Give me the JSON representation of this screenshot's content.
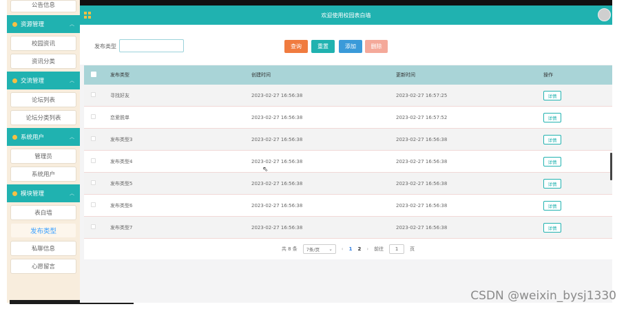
{
  "sidebar": {
    "top_item": "公告信息",
    "groups": [
      {
        "title": "资源管理",
        "items": [
          "校园资讯",
          "资讯分类"
        ]
      },
      {
        "title": "交流管理",
        "items": [
          "论坛列表",
          "论坛分类列表"
        ]
      },
      {
        "title": "系统用户",
        "items": [
          "管理员",
          "系统用户"
        ]
      },
      {
        "title": "模块管理",
        "items": [
          "表白墙",
          "发布类型",
          "私聊信息",
          "心愿留言"
        ]
      }
    ],
    "active_item": "发布类型"
  },
  "header": {
    "title": "欢迎使用校园表白墙"
  },
  "filter": {
    "label": "发布类型",
    "input_value": "",
    "buttons": {
      "search": "查询",
      "reset": "重置",
      "add": "添加",
      "delete": "删除"
    }
  },
  "table": {
    "columns": [
      "发布类型",
      "创建时间",
      "更新时间",
      "操作"
    ],
    "rows": [
      {
        "type": "寻找好友",
        "created": "2023-02-27 16:56:38",
        "updated": "2023-02-27 16:57:25",
        "action": "详情"
      },
      {
        "type": "恋爱脱单",
        "created": "2023-02-27 16:56:38",
        "updated": "2023-02-27 16:57:52",
        "action": "详情"
      },
      {
        "type": "发布类型3",
        "created": "2023-02-27 16:56:38",
        "updated": "2023-02-27 16:56:38",
        "action": "详情"
      },
      {
        "type": "发布类型4",
        "created": "2023-02-27 16:56:38",
        "updated": "2023-02-27 16:56:38",
        "action": "详情"
      },
      {
        "type": "发布类型5",
        "created": "2023-02-27 16:56:38",
        "updated": "2023-02-27 16:56:38",
        "action": "详情"
      },
      {
        "type": "发布类型6",
        "created": "2023-02-27 16:56:38",
        "updated": "2023-02-27 16:56:38",
        "action": "详情"
      },
      {
        "type": "发布类型7",
        "created": "2023-02-27 16:56:38",
        "updated": "2023-02-27 16:56:38",
        "action": "详情"
      }
    ]
  },
  "pager": {
    "total": "共 8 条",
    "page_size": "7条/页",
    "pages": [
      "1",
      "2"
    ],
    "current": "1",
    "goto_label": "前往",
    "goto_value": "1",
    "page_unit": "页",
    "prev": "‹",
    "next": "›"
  },
  "watermark": "CSDN @weixin_bysj1330",
  "colors": {
    "accent": "#20b2b0",
    "search": "#f07b3f",
    "add": "#3a9ad9",
    "delete": "#f4a99a",
    "sidebar_bg": "#f8eddd",
    "table_head": "#a9d4d7"
  }
}
